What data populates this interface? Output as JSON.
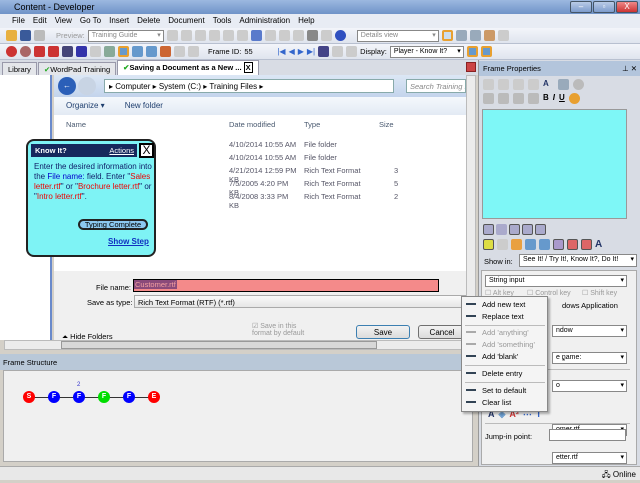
{
  "window": {
    "title": "Content - Developer",
    "min": "‒",
    "max": "▫",
    "close": "X"
  },
  "menu": [
    "File",
    "Edit",
    "View",
    "Go To",
    "Insert",
    "Delete",
    "Document",
    "Tools",
    "Administration",
    "Help"
  ],
  "toolbar1": {
    "preview_label": "Preview:",
    "preview_value": "Training Guide",
    "view_value": "Details view"
  },
  "toolbar2": {
    "frame_id_label": "Frame ID:",
    "frame_id": "55",
    "display_label": "Display:",
    "display_value": "Player - Know It?"
  },
  "tabs": [
    {
      "label": "Library"
    },
    {
      "label": "WordPad Training"
    },
    {
      "label": "Saving a Document as a New ...",
      "close": "X"
    }
  ],
  "dialog": {
    "breadcrumb": [
      "Computer",
      "System (C:)",
      "Training Files"
    ],
    "search_placeholder": "Search Training Files",
    "organize": "Organize ▾",
    "new_folder": "New folder",
    "columns": [
      "Name",
      "Date modified",
      "Type",
      "Size"
    ],
    "rows": [
      {
        "date": "4/10/2014 10:55 AM",
        "type": "File folder",
        "size": ""
      },
      {
        "date": "4/10/2014 10:55 AM",
        "type": "File folder",
        "size": ""
      },
      {
        "date": "4/21/2014 12:59 PM",
        "type": "Rich Text Format",
        "size": "3 KB"
      },
      {
        "date": "7/5/2005 4:20 PM",
        "type": "Rich Text Format",
        "size": "5 KB"
      },
      {
        "date": "8/4/2008 3:33 PM",
        "type": "Rich Text Format",
        "size": "2 KB"
      }
    ],
    "file_name_label": "File name:",
    "file_name_value": "Customer.rtf",
    "save_type_label": "Save as type:",
    "save_type_value": "Rich Text Format (RTF) (*.rtf)",
    "save_default_label": "Save in this format by default",
    "save": "Save",
    "cancel": "Cancel",
    "hide_folders": "Hide Folders"
  },
  "bubble": {
    "title": "Know It?",
    "actions": "Actions",
    "close": "X",
    "t1": "Enter the desired information into the ",
    "t2": "File name:",
    "t3": " field. Enter \"",
    "t4": "Sales letter.rtf",
    "t5": "\" or \"",
    "t6": "Brochure letter.rtf",
    "t7": "\" or \"",
    "t8": "Intro letter.rtf",
    "t9": "\".",
    "typing_complete": "Typing Complete",
    "show_step": "Show Step"
  },
  "frame_structure": {
    "title": "Frame Structure",
    "nodes": [
      {
        "label": "S",
        "color": "#ff0000"
      },
      {
        "label": "F",
        "color": "#0000ff"
      },
      {
        "label": "F",
        "color": "#0000ff",
        "badge": "2"
      },
      {
        "label": "F",
        "color": "#00dd00"
      },
      {
        "label": "F",
        "color": "#0000ff"
      },
      {
        "label": "E",
        "color": "#ff0000"
      }
    ]
  },
  "frame_properties": {
    "title": "Frame Properties",
    "show_in_label": "Show in:",
    "show_in_value": "See It! / Try It!, Know It?, Do It!",
    "input_type": "String input",
    "alt_key": "Alt key",
    "control_key": "Control key",
    "shift_key": "Shift key",
    "app_label": "dows Application",
    "window_value": "ndow",
    "name_value": "e name:",
    "dd_value": "o",
    "star": "*",
    "text_value": "omer.rtf",
    "list_value": "etter.rtf",
    "jump_in_label": "Jump-in point:"
  },
  "context_menu": [
    {
      "label": "Add new text",
      "disabled": false
    },
    {
      "label": "Replace text",
      "disabled": false
    },
    {
      "label": "Add 'anything'",
      "disabled": true
    },
    {
      "label": "Add 'something'",
      "disabled": true
    },
    {
      "label": "Add 'blank'",
      "disabled": false
    },
    {
      "label": "Delete entry",
      "disabled": false
    },
    {
      "label": "Set to default",
      "disabled": false
    },
    {
      "label": "Clear list",
      "disabled": false
    }
  ],
  "status": {
    "online": "Online"
  }
}
